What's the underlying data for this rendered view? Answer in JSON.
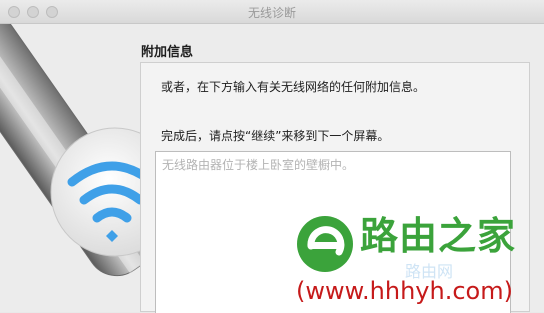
{
  "window": {
    "title": "无线诊断"
  },
  "section": {
    "title": "附加信息"
  },
  "panel": {
    "intro": "或者，在下方输入有关无线网络的任何附加信息。",
    "instruction": "完成后，请点按“继续”来移到下一个屏幕。",
    "textarea_placeholder": "无线路由器位于楼上卧室的壁橱中。"
  },
  "watermark": {
    "brand": "路由之家",
    "faint_text": "路由网",
    "url": "(www.hhhyh.com)"
  },
  "icons": {
    "sidebar_art": "wireless-diagnostics-icon",
    "wifi": "wifi-icon",
    "logo": "router-home-logo-icon"
  },
  "colors": {
    "wifi_blue": "#3fa0e8",
    "brand_green": "#3ba33b",
    "url_red": "#c61a1a"
  }
}
